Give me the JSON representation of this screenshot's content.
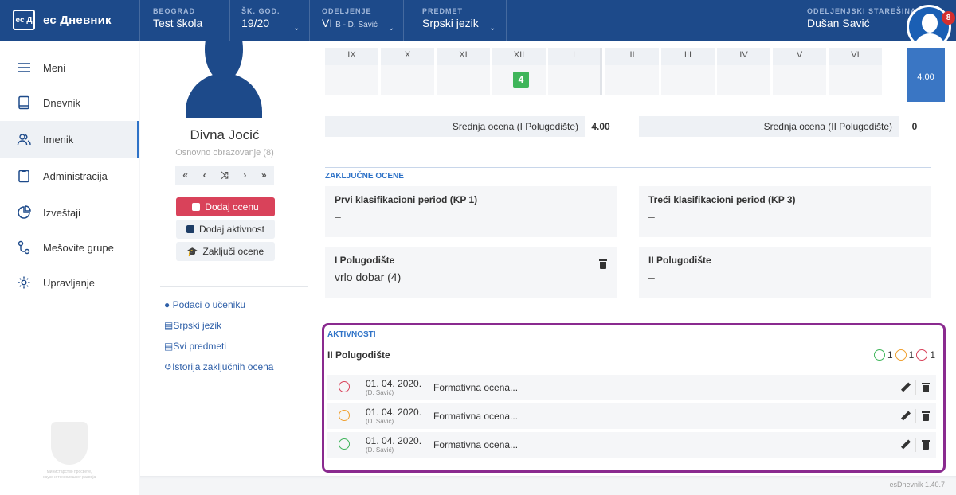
{
  "header": {
    "logo_box": "ес Д",
    "logo_text": "ес Дневник",
    "city_label": "BEOGRAD",
    "school_value": "Test škola",
    "year_label": "ŠK. GOD.",
    "year_value": "19/20",
    "class_label": "ODELJENJE",
    "class_value": "VI",
    "class_sub": "B",
    "class_teacher": " - D. Savić",
    "subject_label": "PREDMET",
    "subject_value": "Srpski jezik",
    "head_teacher_label": "ODELJENJSKI STAREŠINA",
    "head_teacher_value": "Dušan Savić",
    "notification_count": "8"
  },
  "sidebar": {
    "items": [
      {
        "label": "Meni",
        "icon": "menu-icon"
      },
      {
        "label": "Dnevnik",
        "icon": "book-icon"
      },
      {
        "label": "Imenik",
        "icon": "users-icon"
      },
      {
        "label": "Administracija",
        "icon": "clipboard-icon"
      },
      {
        "label": "Izveštaji",
        "icon": "pie-chart-icon"
      },
      {
        "label": "Mešovite grupe",
        "icon": "groups-icon"
      },
      {
        "label": "Upravljanje",
        "icon": "gear-icon"
      }
    ],
    "ministry_text": "Министарство просвете, науке и технолошког развоја"
  },
  "student": {
    "name": "Divna Jocić",
    "level": "Osnovno obrazovanje (8)",
    "pager": [
      "«",
      "‹",
      "⤨",
      "›",
      "»"
    ],
    "add_grade": "Dodaj ocenu",
    "add_activity": "Dodaj aktivnost",
    "finalize": "Zaključi ocene",
    "links": [
      "Podaci o učeniku",
      "Srpski jezik",
      "Svi predmeti",
      "Istorija zaključnih ocena"
    ]
  },
  "grades": {
    "months": [
      "IX",
      "X",
      "XI",
      "XII",
      "I",
      "II",
      "III",
      "IV",
      "V",
      "VI"
    ],
    "grade_value": "4",
    "average": "4.00",
    "avg_h1_label": "Srednja ocena (I Polugodište)",
    "avg_h1_value": "4.00",
    "avg_h2_label": "Srednja ocena (II Polugodište)",
    "avg_h2_value": "0"
  },
  "final": {
    "title": "ZAKLJUČNE OCENE",
    "kp1_title": "Prvi klasifikacioni period (KP 1)",
    "kp1_value": "–",
    "kp3_title": "Treći klasifikacioni period (KP 3)",
    "kp3_value": "–",
    "h1_title": "I Polugodište",
    "h1_value": "vrlo dobar (4)",
    "h2_title": "II Polugodište",
    "h2_value": "–"
  },
  "activities": {
    "title": "AKTIVNOSTI",
    "subtitle": "II Polugodište",
    "count_good": "1",
    "count_mid": "1",
    "count_bad": "1",
    "rows": [
      {
        "date": "01. 04. 2020.",
        "teacher": "(D. Savić)",
        "desc": "Formativna ocena...",
        "mood": "bad"
      },
      {
        "date": "01. 04. 2020.",
        "teacher": "(D. Savić)",
        "desc": "Formativna ocena...",
        "mood": "mid"
      },
      {
        "date": "01. 04. 2020.",
        "teacher": "(D. Savić)",
        "desc": "Formativna ocena...",
        "mood": "good"
      }
    ]
  },
  "version": "esDnevnik 1.40.7",
  "colors": {
    "primary": "#1d4a8a",
    "accent": "#2e72c7",
    "danger": "#d9425a",
    "success": "#3fb55a",
    "highlight": "#8a2a8f"
  }
}
